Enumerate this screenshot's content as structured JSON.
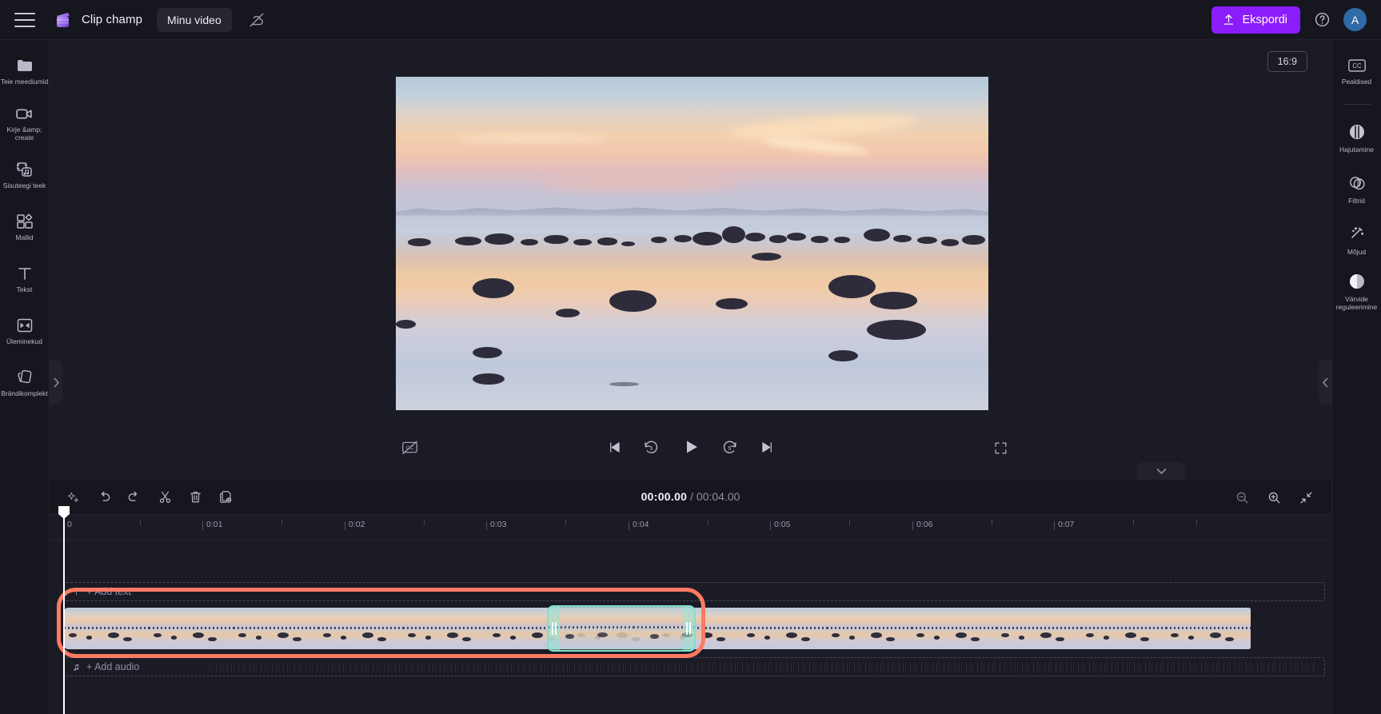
{
  "app": {
    "brand_name": "Clip champ",
    "project_name": "Minu video",
    "menu_icon": "hamburger-icon",
    "cloud_icon": "cloud-off-icon"
  },
  "topbar": {
    "export_label": "Ekspordi",
    "help_label": "?",
    "avatar_initial": "A"
  },
  "left_rail": {
    "items": [
      {
        "label": "Teie meediumid",
        "icon": "folder-icon"
      },
      {
        "label": "Kirje &amp; create",
        "icon": "video-camera-icon"
      },
      {
        "label": "Sisuteegi teek",
        "icon": "content-library-icon"
      },
      {
        "label": "Mallid",
        "icon": "templates-icon"
      },
      {
        "label": "Tekst",
        "icon": "text-icon"
      },
      {
        "label": "Üleminekud",
        "icon": "transitions-icon"
      },
      {
        "label": "Brändikomplekt",
        "icon": "brand-kit-icon"
      }
    ]
  },
  "right_rail": {
    "items": [
      {
        "label": "Pealdised",
        "icon": "closed-caption-icon"
      },
      {
        "label": "Hajutamine",
        "icon": "fade-icon"
      },
      {
        "label": "Filtrid",
        "icon": "filters-icon"
      },
      {
        "label": "Mõjud",
        "icon": "effects-wand-icon"
      },
      {
        "label": "Värvide reguleerimine",
        "icon": "color-adjust-icon"
      }
    ]
  },
  "stage": {
    "aspect_ratio": "16:9",
    "cc_icon": "captions-off-icon",
    "fullscreen_icon": "fullscreen-icon",
    "controls": [
      {
        "name": "skip-start",
        "icon": "skip-to-start-icon"
      },
      {
        "name": "back-5",
        "icon": "rewind-5-icon",
        "value": "5"
      },
      {
        "name": "play",
        "icon": "play-icon"
      },
      {
        "name": "forward-5",
        "icon": "forward-5-icon",
        "value": "5"
      },
      {
        "name": "skip-end",
        "icon": "skip-to-end-icon"
      }
    ]
  },
  "timeline": {
    "current_time": "00:00.00",
    "separator": "/",
    "total_time": "00:04.00",
    "tools": [
      {
        "name": "magic-suggestions",
        "icon": "sparkle-icon"
      },
      {
        "name": "undo",
        "icon": "undo-icon"
      },
      {
        "name": "redo",
        "icon": "redo-icon"
      },
      {
        "name": "split",
        "icon": "scissors-icon"
      },
      {
        "name": "delete",
        "icon": "trash-icon"
      },
      {
        "name": "duplicate",
        "icon": "duplicate-icon"
      }
    ],
    "zoom_tools": [
      {
        "name": "zoom-out",
        "icon": "zoom-out-icon"
      },
      {
        "name": "zoom-in",
        "icon": "zoom-in-icon"
      },
      {
        "name": "fit-to-screen",
        "icon": "fit-screen-icon"
      }
    ],
    "ruler_labels": [
      "0",
      "0:01",
      "0:02",
      "0:03",
      "0:04",
      "0:05",
      "0:06",
      "0:07"
    ],
    "add_text_label": "+ Add text",
    "add_text_icon": "text-t-icon",
    "add_audio_label": "+ Add audio",
    "add_audio_icon": "music-note-icon",
    "selected_clip": {
      "name": "video-clip-selection",
      "accent_color": "#7fe0c8"
    },
    "highlight_color": "#ff7a63",
    "collapse_icon": "chevron-down-icon"
  },
  "panel_handles": {
    "left_icon": "chevron-right-icon",
    "right_icon": "chevron-left-icon"
  }
}
